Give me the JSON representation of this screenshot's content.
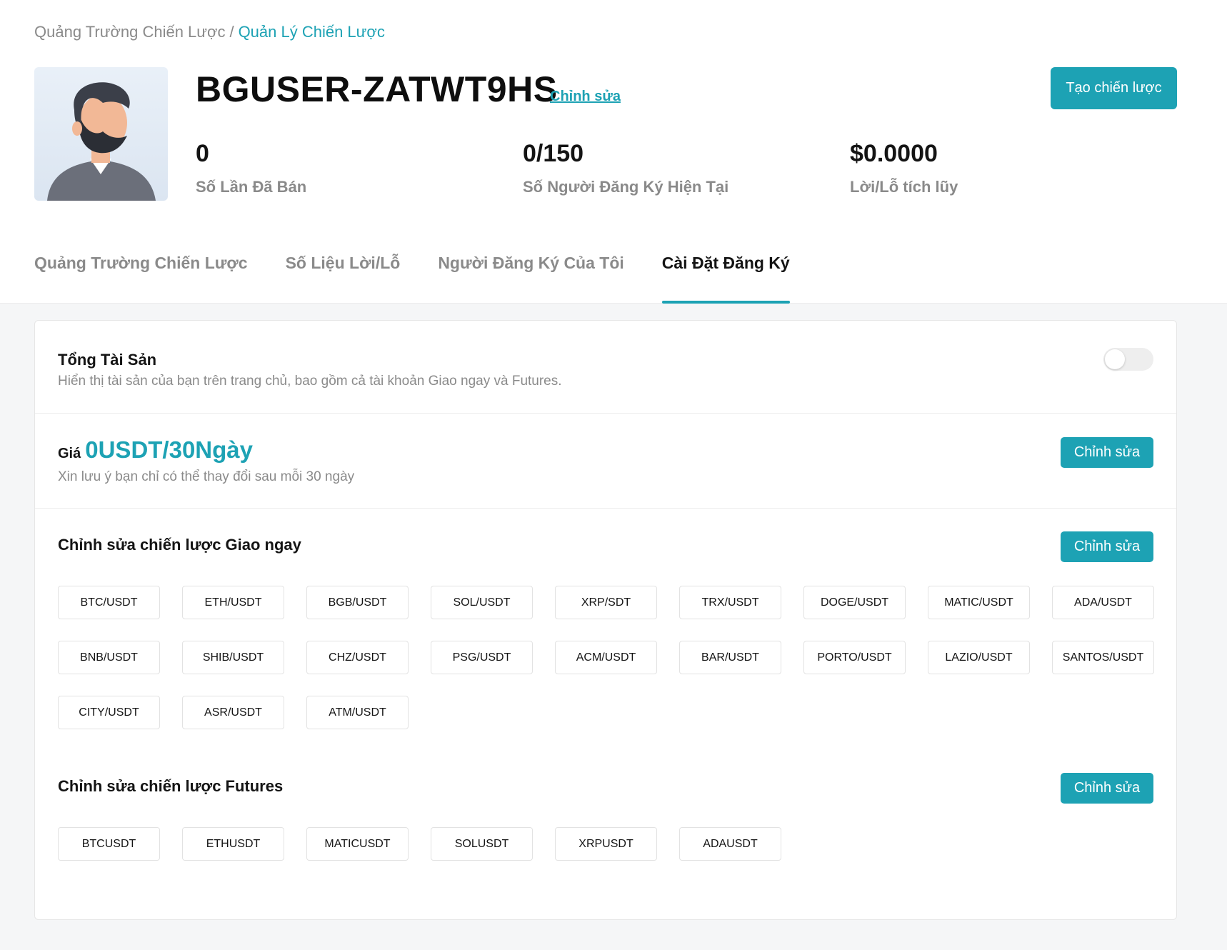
{
  "breadcrumb": {
    "parent": "Quảng Trường Chiến Lược",
    "separator": "/",
    "current": "Quản Lý Chiến Lược"
  },
  "profile": {
    "username": "BGUSER-ZATWT9HS",
    "edit_label": "Chỉnh sửa",
    "create_label": "Tạo chiến lược",
    "stats": [
      {
        "value": "0",
        "label": "Số Lần Đã Bán"
      },
      {
        "value": "0/150",
        "label": "Số Người Đăng Ký Hiện Tại"
      },
      {
        "value": "$0.0000",
        "label": "Lời/Lỗ tích lũy"
      }
    ]
  },
  "tabs": [
    {
      "label": "Quảng Trường Chiến Lược",
      "active": false
    },
    {
      "label": "Số Liệu Lời/Lỗ",
      "active": false
    },
    {
      "label": "Người Đăng Ký Của Tôi",
      "active": false
    },
    {
      "label": "Cài Đặt Đăng Ký",
      "active": true
    }
  ],
  "assets": {
    "title": "Tổng Tài Sản",
    "description": "Hiển thị tài sản của bạn trên trang chủ, bao gồm cả tài khoản Giao ngay và Futures.",
    "toggle_on": false
  },
  "price": {
    "label": "Giá",
    "value": "0USDT/30Ngày",
    "note": "Xin lưu ý bạn chỉ có thể thay đổi sau mỗi 30 ngày",
    "edit_label": "Chỉnh sửa"
  },
  "spot": {
    "title": "Chỉnh sửa chiến lược Giao ngay",
    "edit_label": "Chỉnh sửa",
    "pairs": [
      "BTC/USDT",
      "ETH/USDT",
      "BGB/USDT",
      "SOL/USDT",
      "XRP/SDT",
      "TRX/USDT",
      "DOGE/USDT",
      "MATIC/USDT",
      "ADA/USDT",
      "BNB/USDT",
      "SHIB/USDT",
      "CHZ/USDT",
      "PSG/USDT",
      "ACM/USDT",
      "BAR/USDT",
      "PORTO/USDT",
      "LAZIO/USDT",
      "SANTOS/USDT",
      "CITY/USDT",
      "ASR/USDT",
      "ATM/USDT"
    ]
  },
  "futures": {
    "title": "Chỉnh sửa chiến lược Futures",
    "edit_label": "Chỉnh sửa",
    "pairs": [
      "BTCUSDT",
      "ETHUSDT",
      "MATICUSDT",
      "SOLUSDT",
      "XRPUSDT",
      "ADAUSDT"
    ]
  },
  "colors": {
    "accent": "#1da2b4",
    "muted": "#8a8a8a",
    "text": "#141414"
  },
  "icons": {
    "avatar": "user-avatar-illustration",
    "toggle": "toggle-switch"
  }
}
